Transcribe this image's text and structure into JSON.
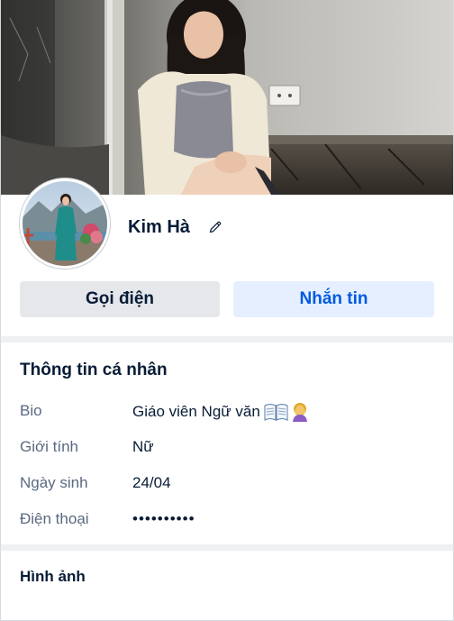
{
  "profile": {
    "name": "Kim Hà"
  },
  "actions": {
    "call_label": "Gọi điện",
    "message_label": "Nhắn tin"
  },
  "info": {
    "title": "Thông tin cá nhân",
    "rows": [
      {
        "label": "Bio",
        "value": "Giáo viên Ngữ văn"
      },
      {
        "label": "Giới tính",
        "value": "Nữ"
      },
      {
        "label": "Ngày sinh",
        "value": "24/04"
      },
      {
        "label": "Điện thoại",
        "value": "••••••••••"
      }
    ]
  },
  "photos": {
    "title": "Hình ảnh"
  },
  "colors": {
    "primary": "#005ae0",
    "primary_bg": "#e5efff",
    "secondary_bg": "#e5e7eb",
    "text": "#081c36",
    "muted": "#5a6981",
    "divider": "#eef0f1"
  },
  "icons": {
    "edit": "pencil-icon",
    "bio_emoji_1": "open-book-emoji",
    "bio_emoji_2": "person-emoji"
  }
}
